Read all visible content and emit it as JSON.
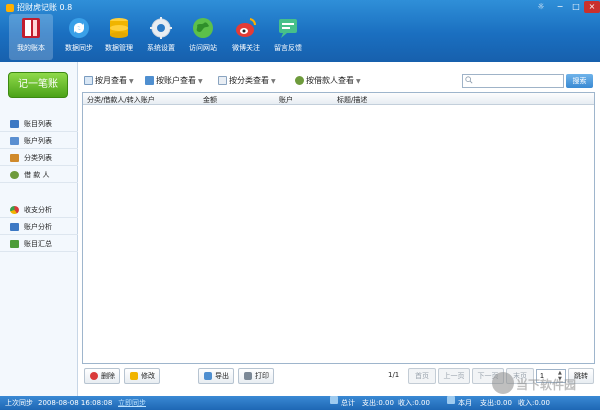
{
  "window": {
    "title": "招财虎记账 0.8"
  },
  "toolbar": {
    "items": [
      {
        "label": "我的账本",
        "icon": "ledger-book-icon",
        "active": true
      },
      {
        "label": "数据同步",
        "icon": "sync-icon"
      },
      {
        "label": "数据管理",
        "icon": "database-icon"
      },
      {
        "label": "系统设置",
        "icon": "gear-icon"
      },
      {
        "label": "访问网站",
        "icon": "globe-icon"
      },
      {
        "label": "微博关注",
        "icon": "weibo-icon"
      },
      {
        "label": "留言反馈",
        "icon": "feedback-icon"
      }
    ]
  },
  "sidebar": {
    "quick_add": "记一笔账",
    "items": [
      {
        "label": "账目列表",
        "icon": "list-icon",
        "color": "#3b78c4"
      },
      {
        "label": "账户列表",
        "icon": "account-icon",
        "color": "#5a8fd1"
      },
      {
        "label": "分类列表",
        "icon": "category-icon",
        "color": "#d08a2b"
      },
      {
        "label": "借 款 人",
        "icon": "people-icon",
        "color": "#6e9b3c"
      },
      {
        "label": "收支分析",
        "icon": "pie-chart-icon",
        "color": "#d93a3a"
      },
      {
        "label": "账户分析",
        "icon": "bar-chart-icon",
        "color": "#3b78c4"
      },
      {
        "label": "账目汇总",
        "icon": "summary-icon",
        "color": "#4c9c3a"
      }
    ]
  },
  "views": {
    "by_month": "按月查看",
    "by_account": "按账户查看",
    "by_category": "按分类查看",
    "by_borrower": "按借款人查看"
  },
  "search": {
    "button": "搜索",
    "placeholder": ""
  },
  "table": {
    "columns": [
      "分类/借款人/转入账户",
      "金额",
      "账户",
      "标题/描述"
    ],
    "rows": []
  },
  "actions": {
    "delete": "删除",
    "edit": "修改",
    "export": "导出",
    "print": "打印"
  },
  "pagination": {
    "count": "1/1",
    "first": "首页",
    "prev": "上一页",
    "next": "下一页",
    "last": "末页",
    "page_value": "1",
    "jump": "跳转"
  },
  "status": {
    "last_sync_label": "上次同步",
    "last_sync_time": "2008-08-08 16:08:08",
    "sync_now": "立即同步",
    "total_label": "总计",
    "total_expense": "支出:0.00",
    "total_income": "收入:0.00",
    "month_label": "本月",
    "month_expense": "支出:0.00",
    "month_income": "收入:0.00"
  },
  "watermark": {
    "text": "当下软件园"
  },
  "colors": {
    "accent": "#1a6fc0",
    "quick_add": "#4ba318"
  }
}
